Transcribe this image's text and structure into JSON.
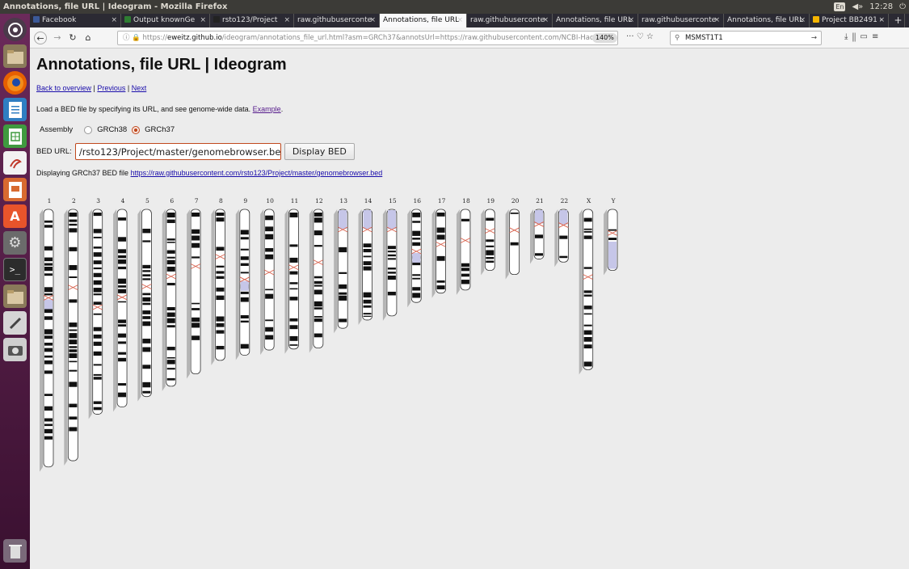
{
  "window": {
    "title": "Annotations, file URL | Ideogram - Mozilla Firefox",
    "tray": {
      "keyboard": "En",
      "volume": "◀»",
      "time": "12:28",
      "power": "⏻"
    }
  },
  "tabs": [
    {
      "label": "Facebook",
      "icon_color": "#3b5998",
      "width": 113,
      "active": false
    },
    {
      "label": "Output knownGe",
      "icon_color": "#2e7d32",
      "width": 110,
      "active": false
    },
    {
      "label": "rsto123/Project",
      "icon_color": "#222222",
      "width": 104,
      "active": false
    },
    {
      "label": "raw.githubuserconte",
      "icon_color": "",
      "width": 106,
      "active": false
    },
    {
      "label": "Annotations, file URL",
      "icon_color": "",
      "width": 108,
      "active": true
    },
    {
      "label": "raw.githubuserconte",
      "icon_color": "",
      "width": 106,
      "active": false
    },
    {
      "label": "Annotations, file URL",
      "icon_color": "",
      "width": 106,
      "active": false
    },
    {
      "label": "raw.githubuserconte",
      "icon_color": "",
      "width": 106,
      "active": false
    },
    {
      "label": "Annotations, file URL",
      "icon_color": "",
      "width": 106,
      "active": false
    },
    {
      "label": "Project BB2491 -",
      "icon_color": "#f4b400",
      "width": 98,
      "active": false
    }
  ],
  "nav": {
    "back": "←",
    "forward": "→",
    "reload": "↻",
    "home": "⌂",
    "url_prefix": "https://",
    "url_host": "eweitz.github.io",
    "url_path": "/ideogram/annotations_file_url.html?asm=GRCh37&annotsUrl=https://raw.githubusercontent.com/NCBI-Hac",
    "zoom": "140%",
    "page_actions": "··· ♡ ☆",
    "search_value": "MSMST1T1",
    "toolbar_icons": "⤓  ⫼  ▭  ≡"
  },
  "page": {
    "heading": "Annotations, file URL | Ideogram",
    "back_link": "Back to overview",
    "previous_link": "Previous",
    "next_link": "Next",
    "description": "Load a BED file by specifying its URL, and see genome-wide data.",
    "example_link": "Example",
    "assembly_label": "Assembly",
    "assembly_options": [
      "GRCh38",
      "GRCh37"
    ],
    "assembly_selected": "GRCh37",
    "bed_label": "BED URL:",
    "bed_input_value": "/rsto123/Project/master/genomebrowser.bed",
    "display_button": "Display BED",
    "displaying_text": "Displaying GRCh37 BED file",
    "displaying_link": "https://raw.githubusercontent.com/rsto123/Project/master/genomebrowser.bed"
  },
  "ideogram": {
    "colors": {
      "band_dark": "#111111",
      "band_light": "#ffffff",
      "acen": "#c6c6e8",
      "annot": "#b5b5b5",
      "centromere": "#d8604b"
    },
    "chromosomes": [
      {
        "name": "1",
        "length": 249
      },
      {
        "name": "2",
        "length": 243
      },
      {
        "name": "3",
        "length": 198
      },
      {
        "name": "4",
        "length": 191
      },
      {
        "name": "5",
        "length": 181
      },
      {
        "name": "6",
        "length": 171
      },
      {
        "name": "7",
        "length": 159
      },
      {
        "name": "8",
        "length": 146
      },
      {
        "name": "9",
        "length": 141
      },
      {
        "name": "10",
        "length": 136
      },
      {
        "name": "11",
        "length": 135
      },
      {
        "name": "12",
        "length": 134
      },
      {
        "name": "13",
        "length": 115
      },
      {
        "name": "14",
        "length": 107
      },
      {
        "name": "15",
        "length": 103
      },
      {
        "name": "16",
        "length": 90
      },
      {
        "name": "17",
        "length": 81
      },
      {
        "name": "18",
        "length": 78
      },
      {
        "name": "19",
        "length": 59
      },
      {
        "name": "20",
        "length": 63
      },
      {
        "name": "21",
        "length": 48
      },
      {
        "name": "22",
        "length": 51
      },
      {
        "name": "X",
        "length": 155
      },
      {
        "name": "Y",
        "length": 59
      }
    ]
  }
}
